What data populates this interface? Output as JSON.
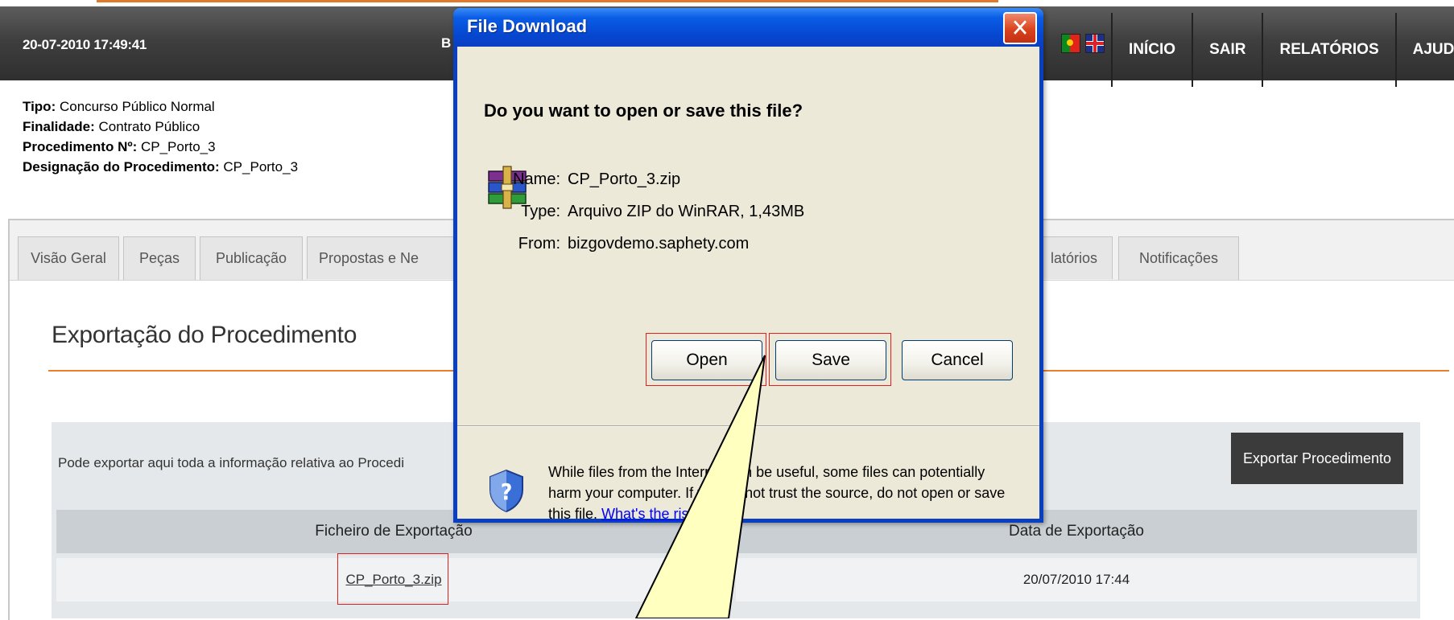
{
  "header": {
    "datetime": "20-07-2010 17:49:41",
    "truncated_text": "B",
    "nav": [
      "INÍCIO",
      "SAIR",
      "RELATÓRIOS",
      "AJUDA"
    ]
  },
  "procedure": {
    "tipo_label": "Tipo:",
    "tipo_value": "Concurso Público Normal",
    "finalidade_label": "Finalidade:",
    "finalidade_value": "Contrato Público",
    "numero_label": "Procedimento Nº:",
    "numero_value": "CP_Porto_3",
    "designacao_label": "Designação do Procedimento:",
    "designacao_value": "CP_Porto_3"
  },
  "tabs": [
    "Visão Geral",
    "Peças",
    "Publicação",
    "Propostas e Ne",
    "latórios",
    "Notificações"
  ],
  "section": {
    "title": "Exportação do Procedimento",
    "description": "Pode exportar aqui toda a informação relativa ao Procedi",
    "export_button": "Exportar Procedimento"
  },
  "table": {
    "headers": [
      "Ficheiro de Exportação",
      "Data de Exportação"
    ],
    "rows": [
      {
        "file": "CP_Porto_3.zip",
        "date": "20/07/2010 17:44"
      }
    ]
  },
  "dialog": {
    "title": "File Download",
    "close": "✕",
    "question": "Do you want to open or save this file?",
    "name_label": "Name:",
    "name_value": "CP_Porto_3.zip",
    "type_label": "Type:",
    "type_value": "Arquivo ZIP do WinRAR, 1,43MB",
    "from_label": "From:",
    "from_value": "bizgovdemo.saphety.com",
    "open": "Open",
    "save": "Save",
    "cancel": "Cancel",
    "warning": "While files from the Internet can be useful, some files can potentially harm your computer. If you do not trust the source, do not open or save this file.",
    "warning_link": "What's the risk?"
  },
  "colors": {
    "accent_orange": "#e6802f",
    "xp_title_blue": "#0a5de6",
    "highlight_red": "#e02020",
    "callout_fill": "#ffffc0"
  },
  "icons": [
    "winrar-archive-icon",
    "shield-question-icon",
    "portugal-flag-icon",
    "uk-flag-icon",
    "close-icon"
  ]
}
